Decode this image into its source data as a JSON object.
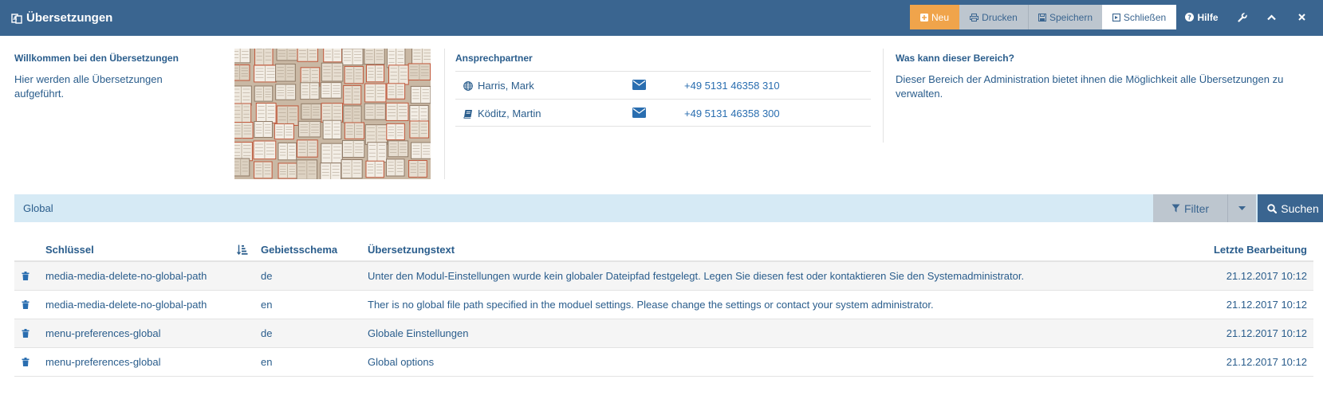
{
  "header": {
    "title": "Übersetzungen",
    "buttons": {
      "new": "Neu",
      "print": "Drucken",
      "save": "Speichern",
      "close": "Schließen",
      "help": "Hilfe"
    },
    "colors": {
      "bar": "#3a6590",
      "accent": "#f0a44b"
    }
  },
  "welcome": {
    "title": "Willkommen bei den Übersetzungen",
    "text": "Hier werden alle Übersetzungen aufgeführt."
  },
  "contacts": {
    "title": "Ansprechpartner",
    "items": [
      {
        "name": "Harris, Mark",
        "icon": "globe-icon",
        "phone": "+49 5131 46358 310"
      },
      {
        "name": "Köditz, Martin",
        "icon": "book-icon",
        "phone": "+49 5131 46358 300"
      }
    ]
  },
  "about": {
    "title": "Was kann dieser Bereich?",
    "text": "Dieser Bereich der Administration bietet ihnen die Möglichkeit alle Übersetzungen zu verwalten."
  },
  "search": {
    "query": "Global",
    "filter_label": "Filter",
    "search_label": "Suchen"
  },
  "table": {
    "columns": {
      "key": "Schlüssel",
      "locale": "Gebietsschema",
      "text": "Übersetzungstext",
      "updated": "Letzte Bearbeitung"
    },
    "rows": [
      {
        "key": "media-media-delete-no-global-path",
        "locale": "de",
        "text": "Unter den Modul-Einstellungen wurde kein globaler Dateipfad festgelegt. Legen Sie diesen fest oder kontaktieren Sie den Systemadministrator.",
        "updated": "21.12.2017 10:12"
      },
      {
        "key": "media-media-delete-no-global-path",
        "locale": "en",
        "text": "Ther is no global file path specified in the moduel settings. Please change the settings or contact your system administrator.",
        "updated": "21.12.2017 10:12"
      },
      {
        "key": "menu-preferences-global",
        "locale": "de",
        "text": "Globale Einstellungen",
        "updated": "21.12.2017 10:12"
      },
      {
        "key": "menu-preferences-global",
        "locale": "en",
        "text": "Global options",
        "updated": "21.12.2017 10:12"
      }
    ]
  }
}
